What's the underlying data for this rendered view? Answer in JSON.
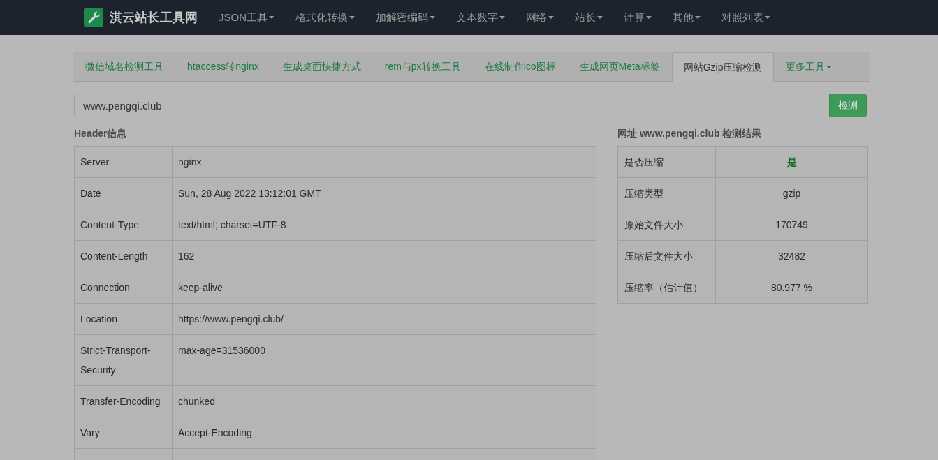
{
  "navbar": {
    "brand": "淇云站长工具网",
    "items": [
      {
        "label": "JSON工具",
        "dropdown": true
      },
      {
        "label": "格式化转换",
        "dropdown": true
      },
      {
        "label": "加解密编码",
        "dropdown": true
      },
      {
        "label": "文本数字",
        "dropdown": true
      },
      {
        "label": "网络",
        "dropdown": true
      },
      {
        "label": "站长",
        "dropdown": true
      },
      {
        "label": "计算",
        "dropdown": true
      },
      {
        "label": "其他",
        "dropdown": true
      },
      {
        "label": "对照列表",
        "dropdown": true
      }
    ]
  },
  "tool_tabs": [
    {
      "label": "微信域名检测工具",
      "selected": false,
      "dropdown": false
    },
    {
      "label": "htaccess转nginx",
      "selected": false,
      "dropdown": false
    },
    {
      "label": "生成桌面快捷方式",
      "selected": false,
      "dropdown": false
    },
    {
      "label": "rem与px转换工具",
      "selected": false,
      "dropdown": false
    },
    {
      "label": "在线制作ico图标",
      "selected": false,
      "dropdown": false
    },
    {
      "label": "生成网页Meta标签",
      "selected": false,
      "dropdown": false
    },
    {
      "label": "网站Gzip压缩检测",
      "selected": true,
      "dropdown": false
    },
    {
      "label": "更多工具",
      "selected": false,
      "dropdown": true
    }
  ],
  "search": {
    "value": "www.pengqi.club",
    "button": "检测"
  },
  "header_panel": {
    "title": "Header信息",
    "rows": [
      {
        "name": "Server",
        "value": "nginx"
      },
      {
        "name": "Date",
        "value": "Sun, 28 Aug 2022 13:12:01 GMT"
      },
      {
        "name": "Content-Type",
        "value": "text/html; charset=UTF-8"
      },
      {
        "name": "Content-Length",
        "value": "162"
      },
      {
        "name": "Connection",
        "value": "keep-alive"
      },
      {
        "name": "Location",
        "value": "https://www.pengqi.club/"
      },
      {
        "name": "Strict-Transport-Security",
        "value": "max-age=31536000"
      },
      {
        "name": "Transfer-Encoding",
        "value": "chunked"
      },
      {
        "name": "Vary",
        "value": "Accept-Encoding"
      }
    ]
  },
  "result_panel": {
    "title": "网址 www.pengqi.club 检测结果",
    "rows": [
      {
        "label": "是否压缩",
        "value": "是",
        "highlight": true
      },
      {
        "label": "压缩类型",
        "value": "gzip",
        "highlight": false
      },
      {
        "label": "原始文件大小",
        "value": "170749",
        "highlight": false
      },
      {
        "label": "压缩后文件大小",
        "value": "32482",
        "highlight": false
      },
      {
        "label": "压缩率（估计值）",
        "value": "80.977 %",
        "highlight": false
      }
    ]
  }
}
